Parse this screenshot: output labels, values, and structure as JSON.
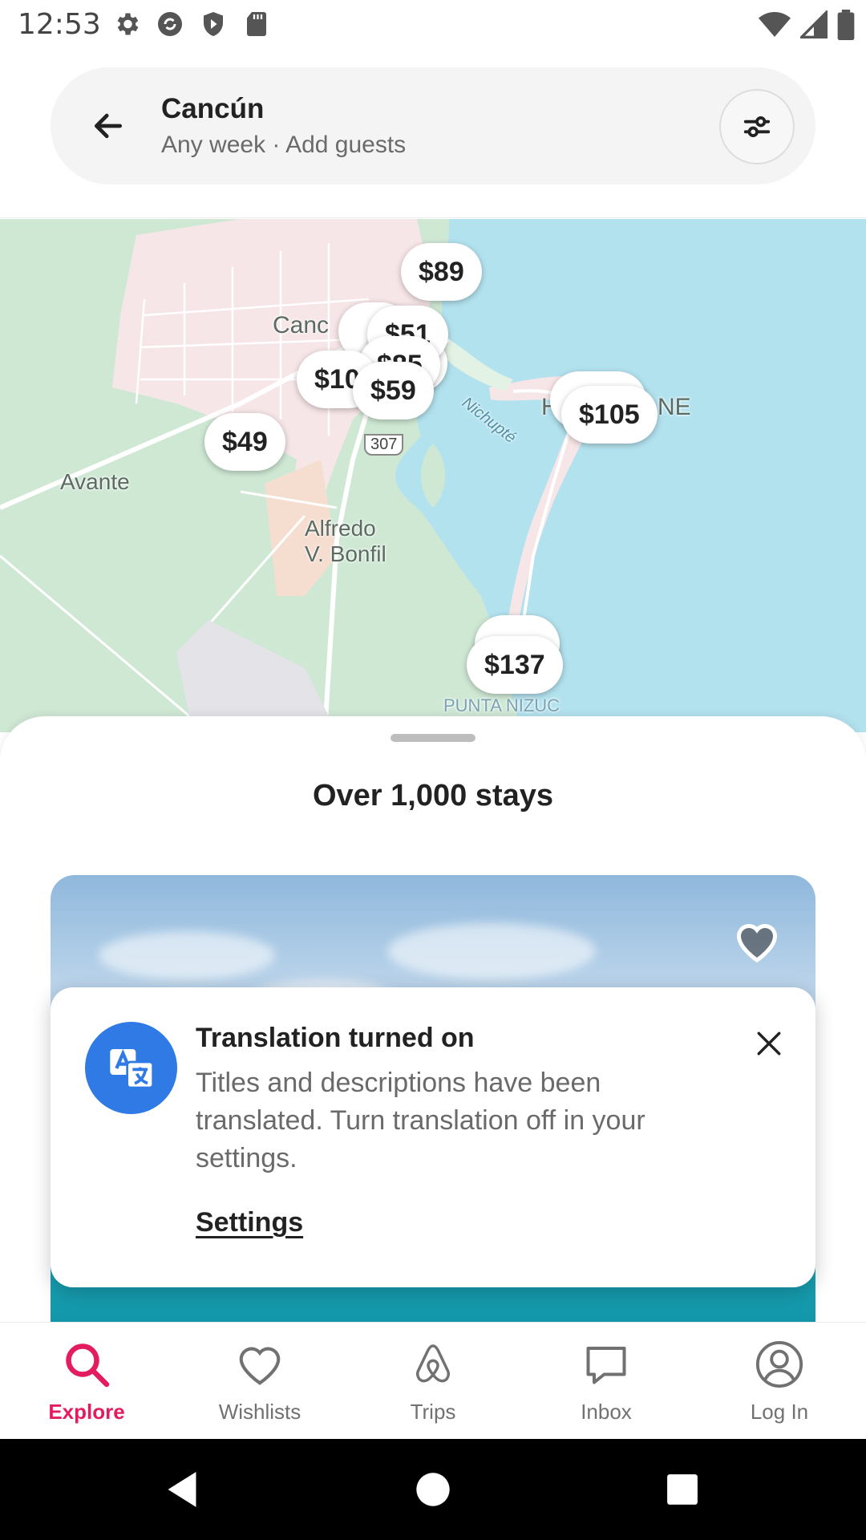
{
  "status_bar": {
    "time": "12:53",
    "left_icons": [
      "settings-icon",
      "sync-icon",
      "play-protect-icon",
      "sd-card-icon"
    ],
    "right_icons": [
      "wifi-icon",
      "signal-icon",
      "battery-icon"
    ]
  },
  "search": {
    "title": "Cancún",
    "subtitle": "Any week · Add guests"
  },
  "map": {
    "labels": {
      "cancun": "Canc",
      "avante": "Avante",
      "alfredo": "Alfredo\nV. Bonfil",
      "highway": "307",
      "nichupte": "Nichupté",
      "hotel_zone_h": "H",
      "hotel_zone_ne": "NE",
      "punta_nizuc": "PUNTA NIZUC"
    },
    "pins": [
      {
        "label": "$89"
      },
      {
        "label": "$51"
      },
      {
        "label": "$85"
      },
      {
        "label": "$10"
      },
      {
        "label": "$59"
      },
      {
        "label": "$49"
      },
      {
        "label": "$105"
      },
      {
        "label": "$137"
      }
    ]
  },
  "sheet": {
    "title": "Over 1,000 stays"
  },
  "toast": {
    "title": "Translation turned on",
    "body": "Titles and descriptions have been translated. Turn translation off in your settings.",
    "link": "Settings"
  },
  "bottom_nav": {
    "items": [
      {
        "label": "Explore",
        "icon": "search-icon",
        "active": true
      },
      {
        "label": "Wishlists",
        "icon": "heart-icon",
        "active": false
      },
      {
        "label": "Trips",
        "icon": "airbnb-logo-icon",
        "active": false
      },
      {
        "label": "Inbox",
        "icon": "message-icon",
        "active": false
      },
      {
        "label": "Log In",
        "icon": "profile-icon",
        "active": false
      }
    ]
  },
  "colors": {
    "accent": "#e31c5f",
    "water": "#b3e2ef",
    "land": "#cfe8d4",
    "urban": "#f7e6e8",
    "toast_icon_bg": "#2f7ae5"
  }
}
